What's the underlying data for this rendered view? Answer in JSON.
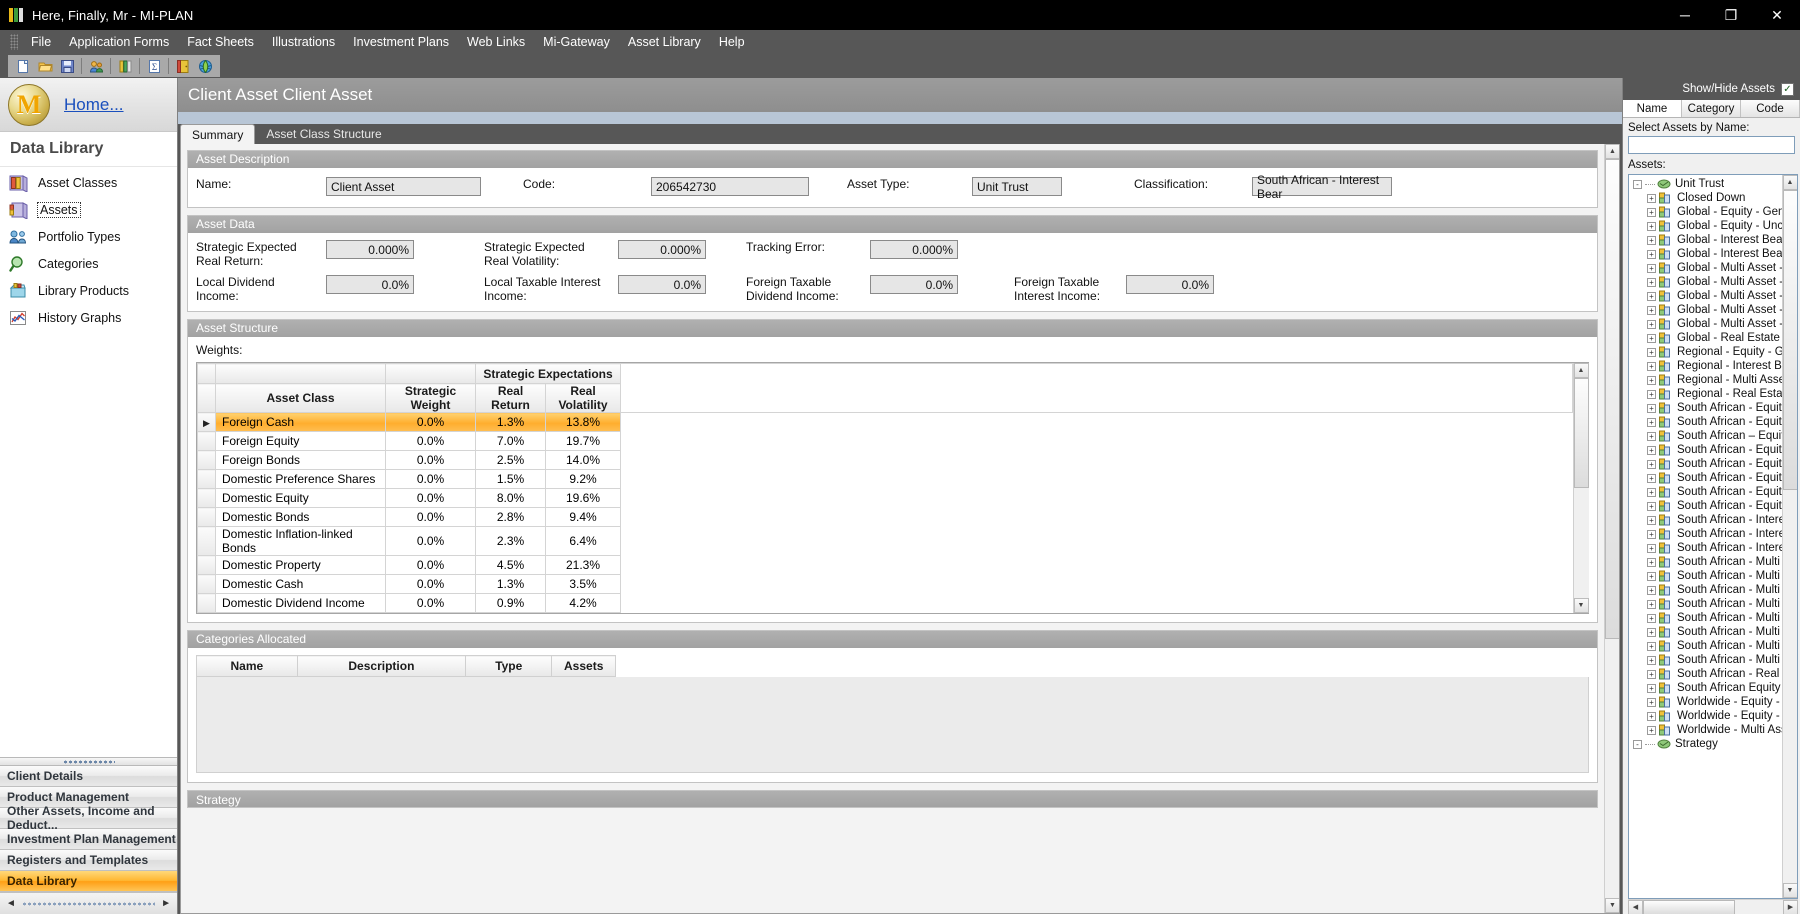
{
  "window": {
    "title": "Here, Finally, Mr - MI-PLAN",
    "minimize": "─",
    "maximize": "❐",
    "close": "✕"
  },
  "menu": {
    "items": [
      {
        "label": "File"
      },
      {
        "label": "Application Forms"
      },
      {
        "label": "Fact Sheets"
      },
      {
        "label": "Illustrations"
      },
      {
        "label": "Investment Plans"
      },
      {
        "label": "Web Links"
      },
      {
        "label": "Mi-Gateway"
      },
      {
        "label": "Asset Library"
      },
      {
        "label": "Help"
      }
    ]
  },
  "toolbar": {
    "buttons": [
      {
        "name": "new-document-icon"
      },
      {
        "name": "open-folder-icon"
      },
      {
        "name": "save-icon"
      },
      {
        "name": "clients-icon"
      },
      {
        "name": "library-icon"
      },
      {
        "name": "summary-icon"
      },
      {
        "name": "exit-door-icon"
      },
      {
        "name": "globe-icon"
      }
    ]
  },
  "sidebar": {
    "home_link": "Home...",
    "logo_letter": "M",
    "section_title": "Data Library",
    "items": [
      {
        "label": "Asset Classes",
        "icon": "asset-classes-icon",
        "focused": false
      },
      {
        "label": "Assets",
        "icon": "assets-icon",
        "focused": true
      },
      {
        "label": "Portfolio Types",
        "icon": "portfolio-types-icon",
        "focused": false
      },
      {
        "label": "Categories",
        "icon": "categories-icon",
        "focused": false
      },
      {
        "label": "Library Products",
        "icon": "library-products-icon",
        "focused": false
      },
      {
        "label": "History Graphs",
        "icon": "history-graphs-icon",
        "focused": false
      }
    ],
    "nav": [
      {
        "label": "Client Details",
        "active": false
      },
      {
        "label": "Product Management",
        "active": false
      },
      {
        "label": "Other Assets, Income and Deduct...",
        "active": false
      },
      {
        "label": "Investment Plan Management",
        "active": false
      },
      {
        "label": "Registers and Templates",
        "active": false
      },
      {
        "label": "Data Library",
        "active": true
      }
    ]
  },
  "page": {
    "title": "Client Asset Client Asset",
    "tabs": [
      {
        "label": "Summary",
        "active": true
      },
      {
        "label": "Asset Class Structure",
        "active": false
      }
    ]
  },
  "asset_description": {
    "title": "Asset Description",
    "name_label": "Name:",
    "name_value": "Client Asset",
    "code_label": "Code:",
    "code_value": "206542730",
    "asset_type_label": "Asset Type:",
    "asset_type_value": "Unit Trust",
    "classification_label": "Classification:",
    "classification_value": "South African - Interest Bear"
  },
  "asset_data": {
    "title": "Asset Data",
    "fields": [
      {
        "label": "Strategic Expected Real Return:",
        "value": "0.000%"
      },
      {
        "label": "Strategic Expected Real Volatility:",
        "value": "0.000%"
      },
      {
        "label": "Tracking Error:",
        "value": "0.000%"
      },
      {
        "label": "Local Dividend Income:",
        "value": "0.0%"
      },
      {
        "label": "Local Taxable Interest Income:",
        "value": "0.0%"
      },
      {
        "label": "Foreign Taxable Dividend Income:",
        "value": "0.0%"
      },
      {
        "label": "Foreign Taxable Interest Income:",
        "value": "0.0%"
      }
    ]
  },
  "asset_structure": {
    "title": "Asset Structure",
    "weights_label": "Weights:",
    "group_header": "Strategic Expectations",
    "columns": [
      "Asset Class",
      "Strategic Weight",
      "Real Return",
      "Real Volatility"
    ],
    "rows": [
      {
        "asset_class": "Foreign Cash",
        "strategic_weight": "0.0%",
        "real_return": "1.3%",
        "real_volatility": "13.8%",
        "selected": true
      },
      {
        "asset_class": "Foreign Equity",
        "strategic_weight": "0.0%",
        "real_return": "7.0%",
        "real_volatility": "19.7%",
        "selected": false
      },
      {
        "asset_class": "Foreign Bonds",
        "strategic_weight": "0.0%",
        "real_return": "2.5%",
        "real_volatility": "14.0%",
        "selected": false
      },
      {
        "asset_class": "Domestic Preference Shares",
        "strategic_weight": "0.0%",
        "real_return": "1.5%",
        "real_volatility": "9.2%",
        "selected": false
      },
      {
        "asset_class": "Domestic Equity",
        "strategic_weight": "0.0%",
        "real_return": "8.0%",
        "real_volatility": "19.6%",
        "selected": false
      },
      {
        "asset_class": "Domestic Bonds",
        "strategic_weight": "0.0%",
        "real_return": "2.8%",
        "real_volatility": "9.4%",
        "selected": false
      },
      {
        "asset_class": "Domestic Inflation-linked Bonds",
        "strategic_weight": "0.0%",
        "real_return": "2.3%",
        "real_volatility": "6.4%",
        "selected": false
      },
      {
        "asset_class": "Domestic Property",
        "strategic_weight": "0.0%",
        "real_return": "4.5%",
        "real_volatility": "21.3%",
        "selected": false
      },
      {
        "asset_class": "Domestic Cash",
        "strategic_weight": "0.0%",
        "real_return": "1.3%",
        "real_volatility": "3.5%",
        "selected": false
      },
      {
        "asset_class": "Domestic Dividend Income",
        "strategic_weight": "0.0%",
        "real_return": "0.9%",
        "real_volatility": "4.2%",
        "selected": false
      }
    ]
  },
  "categories_allocated": {
    "title": "Categories Allocated",
    "columns": [
      "Name",
      "Description",
      "Type",
      "Assets"
    ]
  },
  "strategy": {
    "title": "Strategy"
  },
  "right_panel": {
    "show_hide_label": "Show/Hide Assets",
    "show_hide_checked": "✓",
    "tabs": [
      {
        "label": "Name",
        "active": true
      },
      {
        "label": "Category",
        "active": false
      },
      {
        "label": "Code",
        "active": false
      }
    ],
    "select_label": "Select Assets by Name:",
    "search_value": "",
    "assets_label": "Assets:",
    "tree": [
      {
        "label": "Unit Trust",
        "level": 1,
        "toggle": "-",
        "icon": "folder-root-icon"
      },
      {
        "label": "Closed Down",
        "level": 2,
        "toggle": "+",
        "icon": "asset-group-icon"
      },
      {
        "label": "Global - Equity - General",
        "level": 2,
        "toggle": "+",
        "icon": "asset-group-icon"
      },
      {
        "label": "Global - Equity - Unclassif",
        "level": 2,
        "toggle": "+",
        "icon": "asset-group-icon"
      },
      {
        "label": "Global - Interest Bearing -",
        "level": 2,
        "toggle": "+",
        "icon": "asset-group-icon"
      },
      {
        "label": "Global - Interest Bearing -",
        "level": 2,
        "toggle": "+",
        "icon": "asset-group-icon"
      },
      {
        "label": "Global - Multi Asset - Flex",
        "level": 2,
        "toggle": "+",
        "icon": "asset-group-icon"
      },
      {
        "label": "Global - Multi Asset - High",
        "level": 2,
        "toggle": "+",
        "icon": "asset-group-icon"
      },
      {
        "label": "Global - Multi Asset - Inco",
        "level": 2,
        "toggle": "+",
        "icon": "asset-group-icon"
      },
      {
        "label": "Global - Multi Asset - Low",
        "level": 2,
        "toggle": "+",
        "icon": "asset-group-icon"
      },
      {
        "label": "Global - Multi Asset - Mec",
        "level": 2,
        "toggle": "+",
        "icon": "asset-group-icon"
      },
      {
        "label": "Global - Real Estate - Ger",
        "level": 2,
        "toggle": "+",
        "icon": "asset-group-icon"
      },
      {
        "label": "Regional - Equity - Gener",
        "level": 2,
        "toggle": "+",
        "icon": "asset-group-icon"
      },
      {
        "label": "Regional - Interest Bearin",
        "level": 2,
        "toggle": "+",
        "icon": "asset-group-icon"
      },
      {
        "label": "Regional - Multi Asset - Fl",
        "level": 2,
        "toggle": "+",
        "icon": "asset-group-icon"
      },
      {
        "label": "Regional - Real Estate - (",
        "level": 2,
        "toggle": "+",
        "icon": "asset-group-icon"
      },
      {
        "label": "South African - Equity - Fi",
        "level": 2,
        "toggle": "+",
        "icon": "asset-group-icon"
      },
      {
        "label": "South African - Equity - G",
        "level": 2,
        "toggle": "+",
        "icon": "asset-group-icon"
      },
      {
        "label": "South African – Equity – (",
        "level": 2,
        "toggle": "+",
        "icon": "asset-group-icon"
      },
      {
        "label": "South African - Equity - In",
        "level": 2,
        "toggle": "+",
        "icon": "asset-group-icon"
      },
      {
        "label": "South African - Equity - L",
        "level": 2,
        "toggle": "+",
        "icon": "asset-group-icon"
      },
      {
        "label": "South African - Equity - M",
        "level": 2,
        "toggle": "+",
        "icon": "asset-group-icon"
      },
      {
        "label": "South African - Equity - R",
        "level": 2,
        "toggle": "+",
        "icon": "asset-group-icon"
      },
      {
        "label": "South African - Equity - U",
        "level": 2,
        "toggle": "+",
        "icon": "asset-group-icon"
      },
      {
        "label": "South African - Interest B",
        "level": 2,
        "toggle": "+",
        "icon": "asset-group-icon"
      },
      {
        "label": "South African - Interest B",
        "level": 2,
        "toggle": "+",
        "icon": "asset-group-icon"
      },
      {
        "label": "South African - Interest B",
        "level": 2,
        "toggle": "+",
        "icon": "asset-group-icon"
      },
      {
        "label": "South African - Multi Asse",
        "level": 2,
        "toggle": "+",
        "icon": "asset-group-icon"
      },
      {
        "label": "South African - Multi Asse",
        "level": 2,
        "toggle": "+",
        "icon": "asset-group-icon"
      },
      {
        "label": "South African - Multi Ass",
        "level": 2,
        "toggle": "+",
        "icon": "asset-group-icon"
      },
      {
        "label": "South African - Multi Asse",
        "level": 2,
        "toggle": "+",
        "icon": "asset-group-icon"
      },
      {
        "label": "South African - Multi Ass",
        "level": 2,
        "toggle": "+",
        "icon": "asset-group-icon"
      },
      {
        "label": "South African - Multi Asse",
        "level": 2,
        "toggle": "+",
        "icon": "asset-group-icon"
      },
      {
        "label": "South African - Multi Ass",
        "level": 2,
        "toggle": "+",
        "icon": "asset-group-icon"
      },
      {
        "label": "South African - Multi Asse",
        "level": 2,
        "toggle": "+",
        "icon": "asset-group-icon"
      },
      {
        "label": "South African - Real Esta",
        "level": 2,
        "toggle": "+",
        "icon": "asset-group-icon"
      },
      {
        "label": "South African Equity - Ge",
        "level": 2,
        "toggle": "+",
        "icon": "asset-group-icon"
      },
      {
        "label": "Worldwide - Equity - Gen",
        "level": 2,
        "toggle": "+",
        "icon": "asset-group-icon"
      },
      {
        "label": "Worldwide - Equity - Uncl",
        "level": 2,
        "toggle": "+",
        "icon": "asset-group-icon"
      },
      {
        "label": "Worldwide - Multi Asset -",
        "level": 2,
        "toggle": "+",
        "icon": "asset-group-icon"
      },
      {
        "label": "Strategy",
        "level": 1,
        "toggle": "-",
        "icon": "folder-root-icon"
      }
    ]
  },
  "colors": {
    "accent_orange": "#ffae2e",
    "title_bar": "#000000",
    "chrome": "#575757",
    "link_blue": "#1a4fbd"
  }
}
